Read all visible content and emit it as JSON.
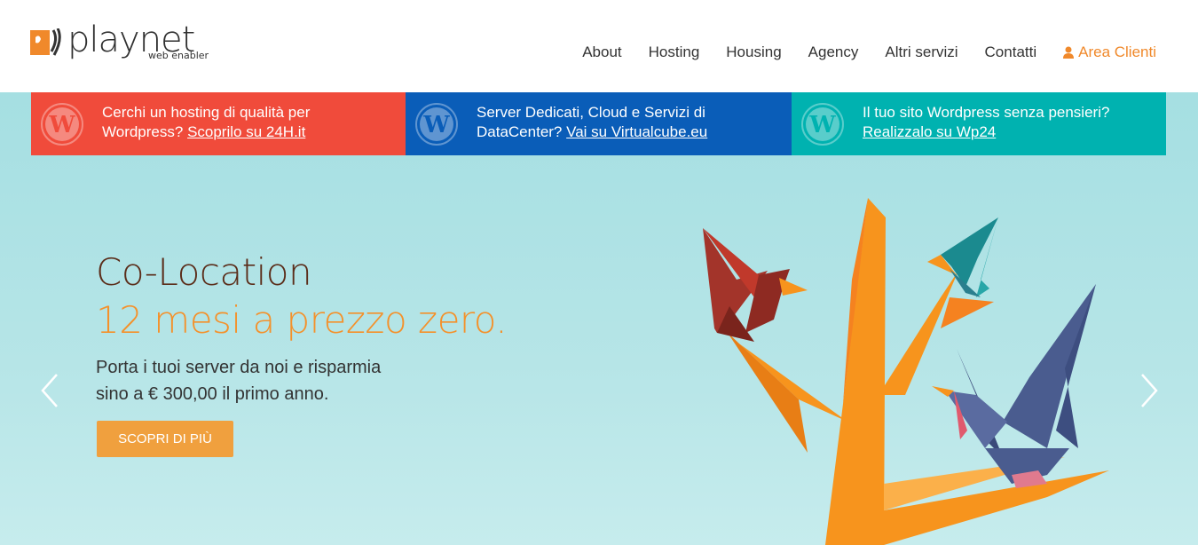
{
  "logo": {
    "brand": "playnet",
    "tagline": "web enabler"
  },
  "nav": {
    "items": [
      {
        "label": "About"
      },
      {
        "label": "Hosting"
      },
      {
        "label": "Housing"
      },
      {
        "label": "Agency"
      },
      {
        "label": "Altri servizi"
      },
      {
        "label": "Contatti"
      }
    ],
    "client_area": "Area Clienti"
  },
  "promo": [
    {
      "line1": "Cerchi un hosting di qualità per",
      "prefix": "Wordpress? ",
      "link": "Scoprilo su 24H.it",
      "color": "#f04b3b",
      "icon": "wordpress-icon"
    },
    {
      "line1": "Server Dedicati, Cloud e Servizi di",
      "prefix": "DataCenter? ",
      "link": "Vai su Virtualcube.eu",
      "color": "#0a5db8",
      "icon": "wordpress-icon"
    },
    {
      "line1": "Il tuo sito Wordpress senza pensieri?",
      "prefix": "",
      "link": "Realizzalo su Wp24",
      "color": "#00b2b0",
      "icon": "wordpress-icon"
    }
  ],
  "hero": {
    "title1": "Co-Location",
    "title2": "12 mesi a prezzo zero.",
    "sub1": "Porta i tuoi server da noi e risparmia",
    "sub2": "sino a € 300,00 il primo anno.",
    "cta": "SCOPRI DI PIÙ"
  },
  "colors": {
    "accent": "#f0892b",
    "hero_title": "#5b2d1a",
    "hero_highlight": "#f4912b"
  }
}
